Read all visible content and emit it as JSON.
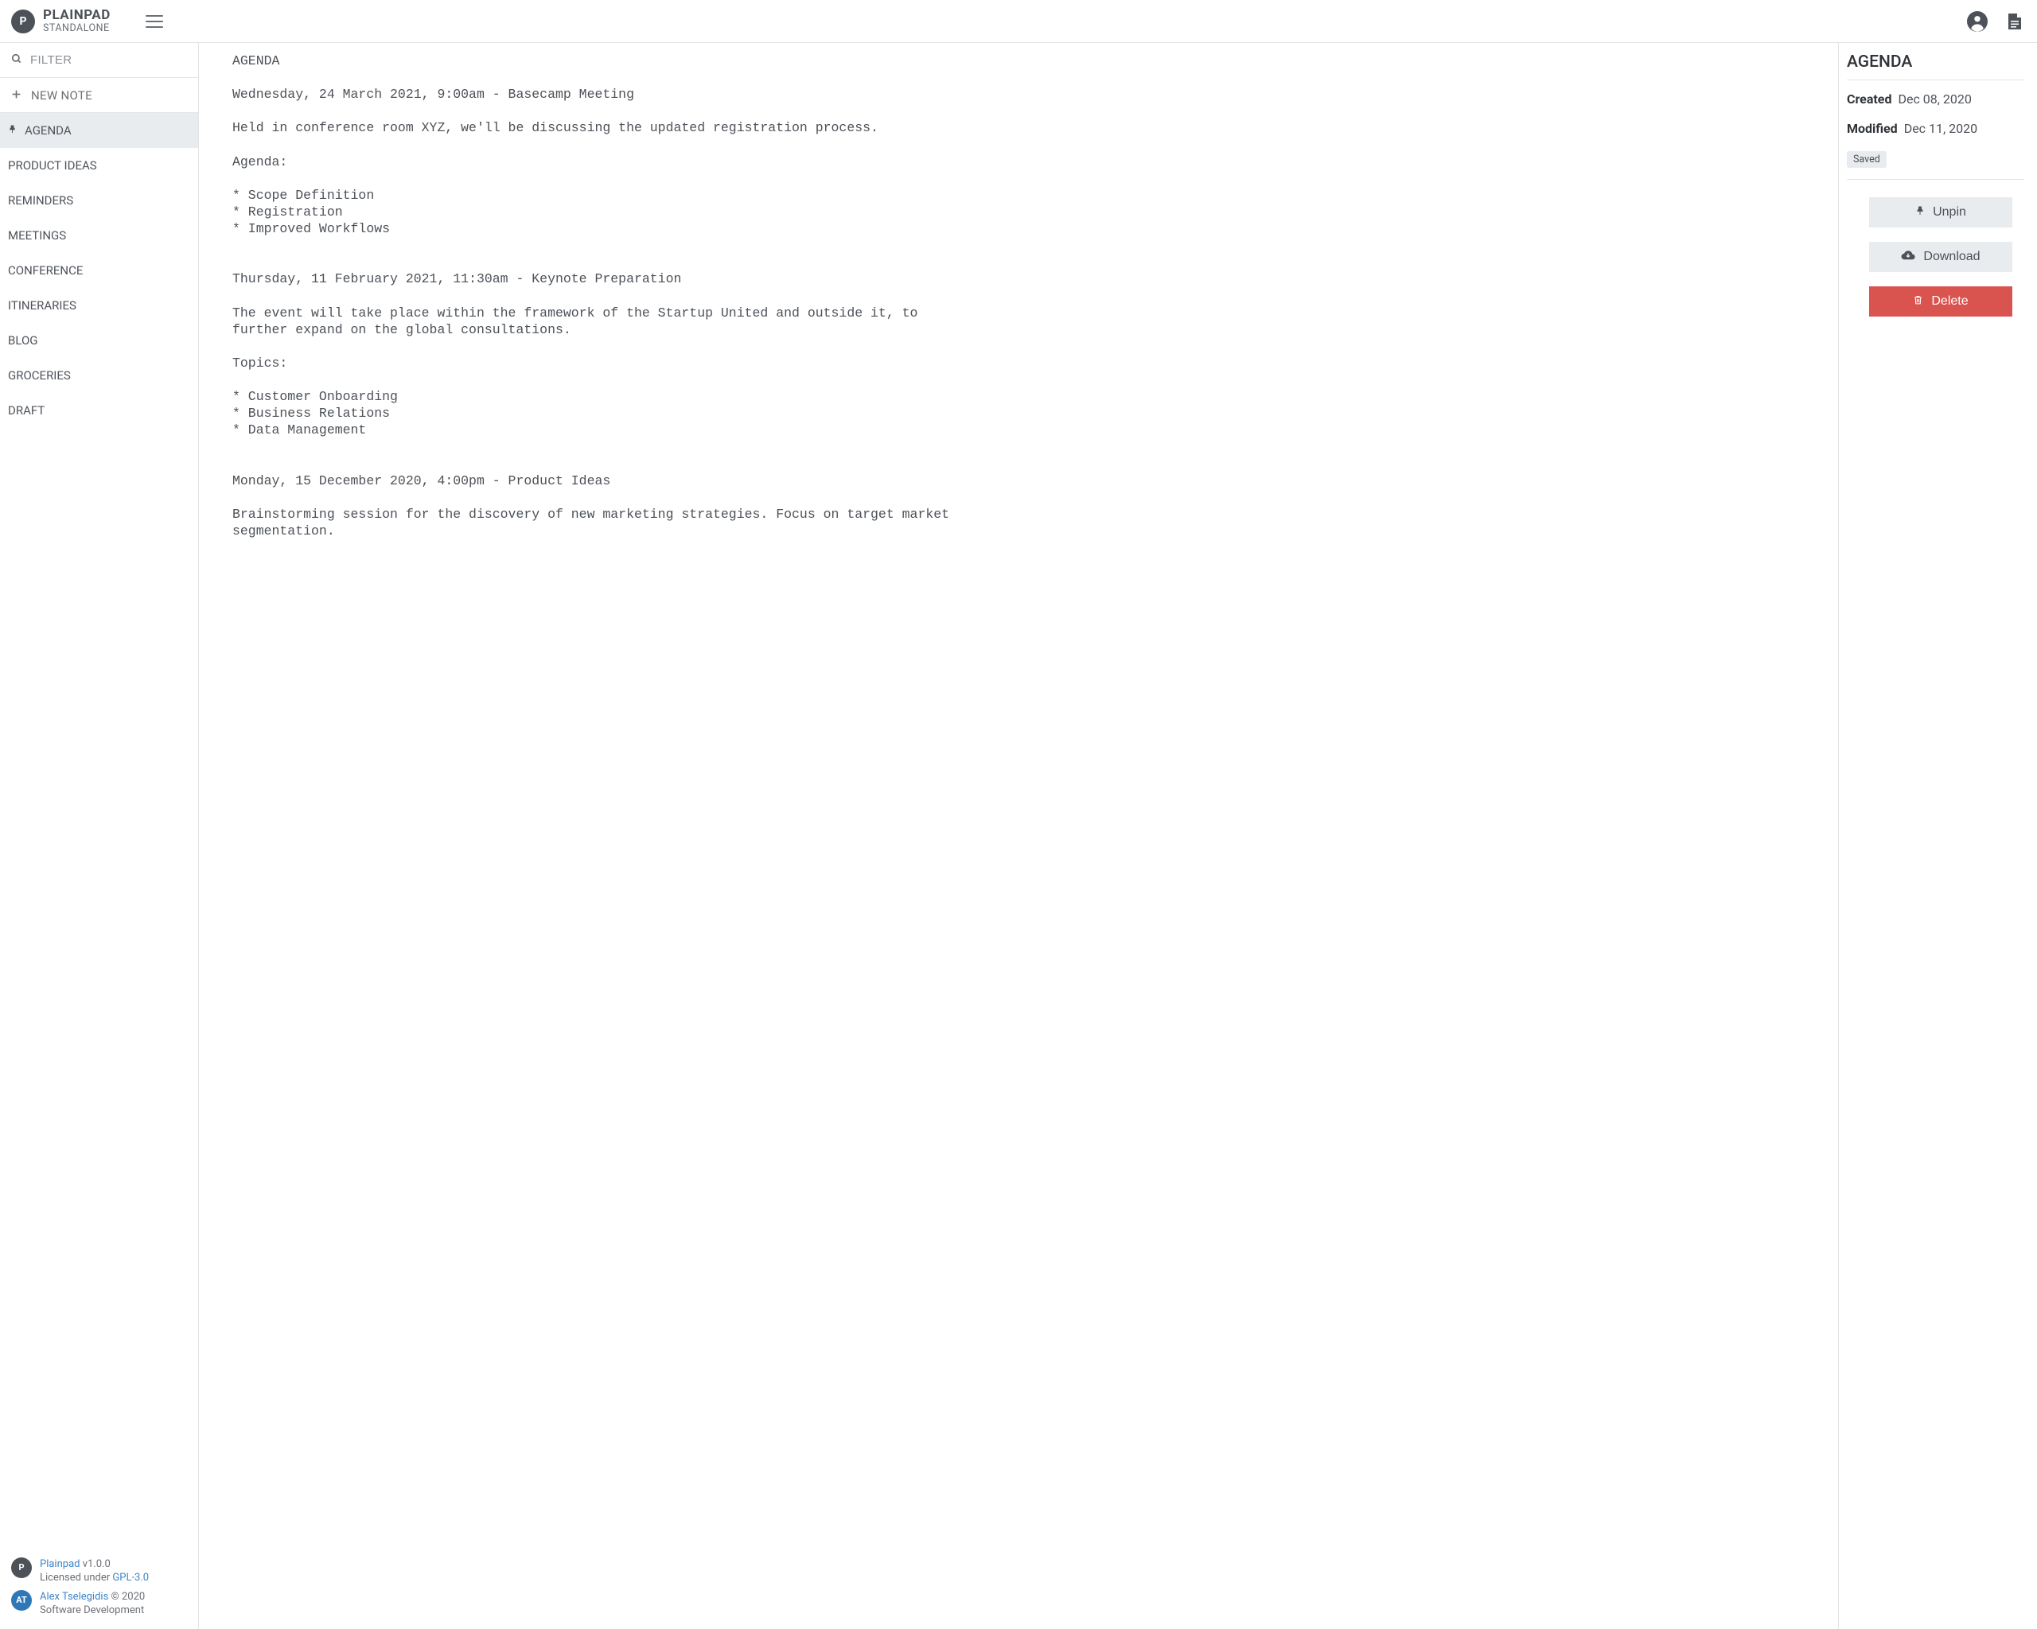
{
  "header": {
    "brand_title": "PLAINPAD",
    "brand_subtitle": "STANDALONE",
    "brand_logo_letter": "P"
  },
  "sidebar": {
    "filter_placeholder": "FILTER",
    "new_note_label": "NEW NOTE",
    "notes": [
      {
        "label": "AGENDA",
        "pinned": true,
        "active": true
      },
      {
        "label": "PRODUCT IDEAS",
        "pinned": false,
        "active": false
      },
      {
        "label": "REMINDERS",
        "pinned": false,
        "active": false
      },
      {
        "label": "MEETINGS",
        "pinned": false,
        "active": false
      },
      {
        "label": "CONFERENCE",
        "pinned": false,
        "active": false
      },
      {
        "label": "ITINERARIES",
        "pinned": false,
        "active": false
      },
      {
        "label": "BLOG",
        "pinned": false,
        "active": false
      },
      {
        "label": "GROCERIES",
        "pinned": false,
        "active": false
      },
      {
        "label": "DRAFT",
        "pinned": false,
        "active": false
      }
    ],
    "footer": {
      "app_name": "Plainpad ",
      "app_version": "v1.0.0",
      "license_prefix": "Licensed under ",
      "license_link": "GPL-3.0",
      "author_name": "Alex Tselegidis ",
      "author_copyright": "© 2020",
      "author_role": "Software Development",
      "logo_letter_1": "P",
      "logo_letter_2": "AT"
    }
  },
  "editor": {
    "content": "AGENDA\n\nWednesday, 24 March 2021, 9:00am - Basecamp Meeting\n\nHeld in conference room XYZ, we'll be discussing the updated registration process.\n\nAgenda:\n\n* Scope Definition\n* Registration\n* Improved Workflows\n\n\nThursday, 11 February 2021, 11:30am - Keynote Preparation\n\nThe event will take place within the framework of the Startup United and outside it, to further expand on the global consultations.\n\nTopics:\n\n* Customer Onboarding\n* Business Relations\n* Data Management\n\n\nMonday, 15 December 2020, 4:00pm - Product Ideas\n\nBrainstorming session for the discovery of new marketing strategies. Focus on target market segmentation."
  },
  "details": {
    "title": "AGENDA",
    "created_label": "Created",
    "created_value": "Dec 08, 2020",
    "modified_label": "Modified",
    "modified_value": "Dec 11, 2020",
    "saved_badge": "Saved",
    "unpin_label": "Unpin",
    "download_label": "Download",
    "delete_label": "Delete"
  }
}
